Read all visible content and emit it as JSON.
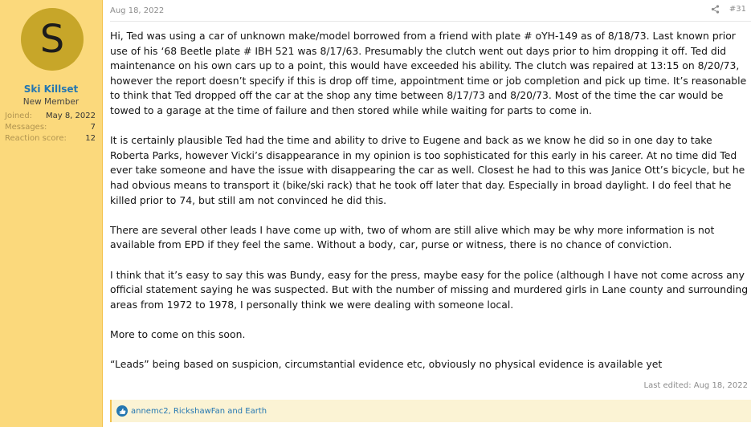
{
  "user": {
    "avatar_letter": "S",
    "name": "Ski Killset",
    "title": "New Member",
    "stats": [
      {
        "label": "Joined:",
        "value": "May 8, 2022"
      },
      {
        "label": "Messages:",
        "value": "7"
      },
      {
        "label": "Reaction score:",
        "value": "12"
      }
    ]
  },
  "post": {
    "date": "Aug 18, 2022",
    "number": "#31",
    "paragraphs": [
      "Hi, Ted was using a car of unknown make/model borrowed from a friend with plate # oYH-149 as of 8/18/73. Last known prior use of his ‘68 Beetle plate # IBH 521 was 8/17/63. Presumably the clutch went out days prior to him dropping it off. Ted did maintenance on his own cars up to a point, this would have exceeded his ability. The clutch was repaired at 13:15 on 8/20/73, however the report doesn’t specify if this is drop off time, appointment time or job completion and pick up time. It’s reasonable to think that Ted dropped off the car at the shop any time between 8/17/73 and 8/20/73. Most of the time the car would be towed to a garage at the time of failure and then stored while while waiting for parts to come in.",
      "It is certainly plausible Ted had the time and ability to drive to Eugene and back as we know he did so in one day to take Roberta Parks, however Vicki’s disappearance in my opinion is too sophisticated for this early in his career. At no time did Ted ever take someone and have the issue with disappearing the car as well. Closest he had to this was Janice Ott’s bicycle, but he had obvious means to transport it (bike/ski rack) that he took off later that day. Especially in broad daylight. I do feel that he killed prior to 74, but still am not convinced he did this.",
      "There are several other leads I have come up with, two of whom are still alive which may be why more information is not available from EPD if they feel the same. Without a body, car, purse or witness, there is no chance of conviction.",
      "I think that it’s easy to say this was Bundy, easy for the press, maybe easy for the police (although I have not come across any official statement saying he was suspected. But with the number of missing and murdered girls in Lane county and surrounding areas from 1972 to 1978, I personally think we were dealing with someone local.",
      "More to come on this soon.",
      "“Leads” being based on suspicion, circumstantial evidence etc, obviously no physical evidence is available yet"
    ],
    "last_edited": "Last edited: Aug 18, 2022",
    "reactions": "annemc2, RickshawFan and Earth"
  },
  "icons": {
    "share": "share-icon",
    "like": "like-icon"
  },
  "colors": {
    "sidebar": "#fbd97c",
    "accent": "#2577b1",
    "avatar": "#c7a629"
  }
}
